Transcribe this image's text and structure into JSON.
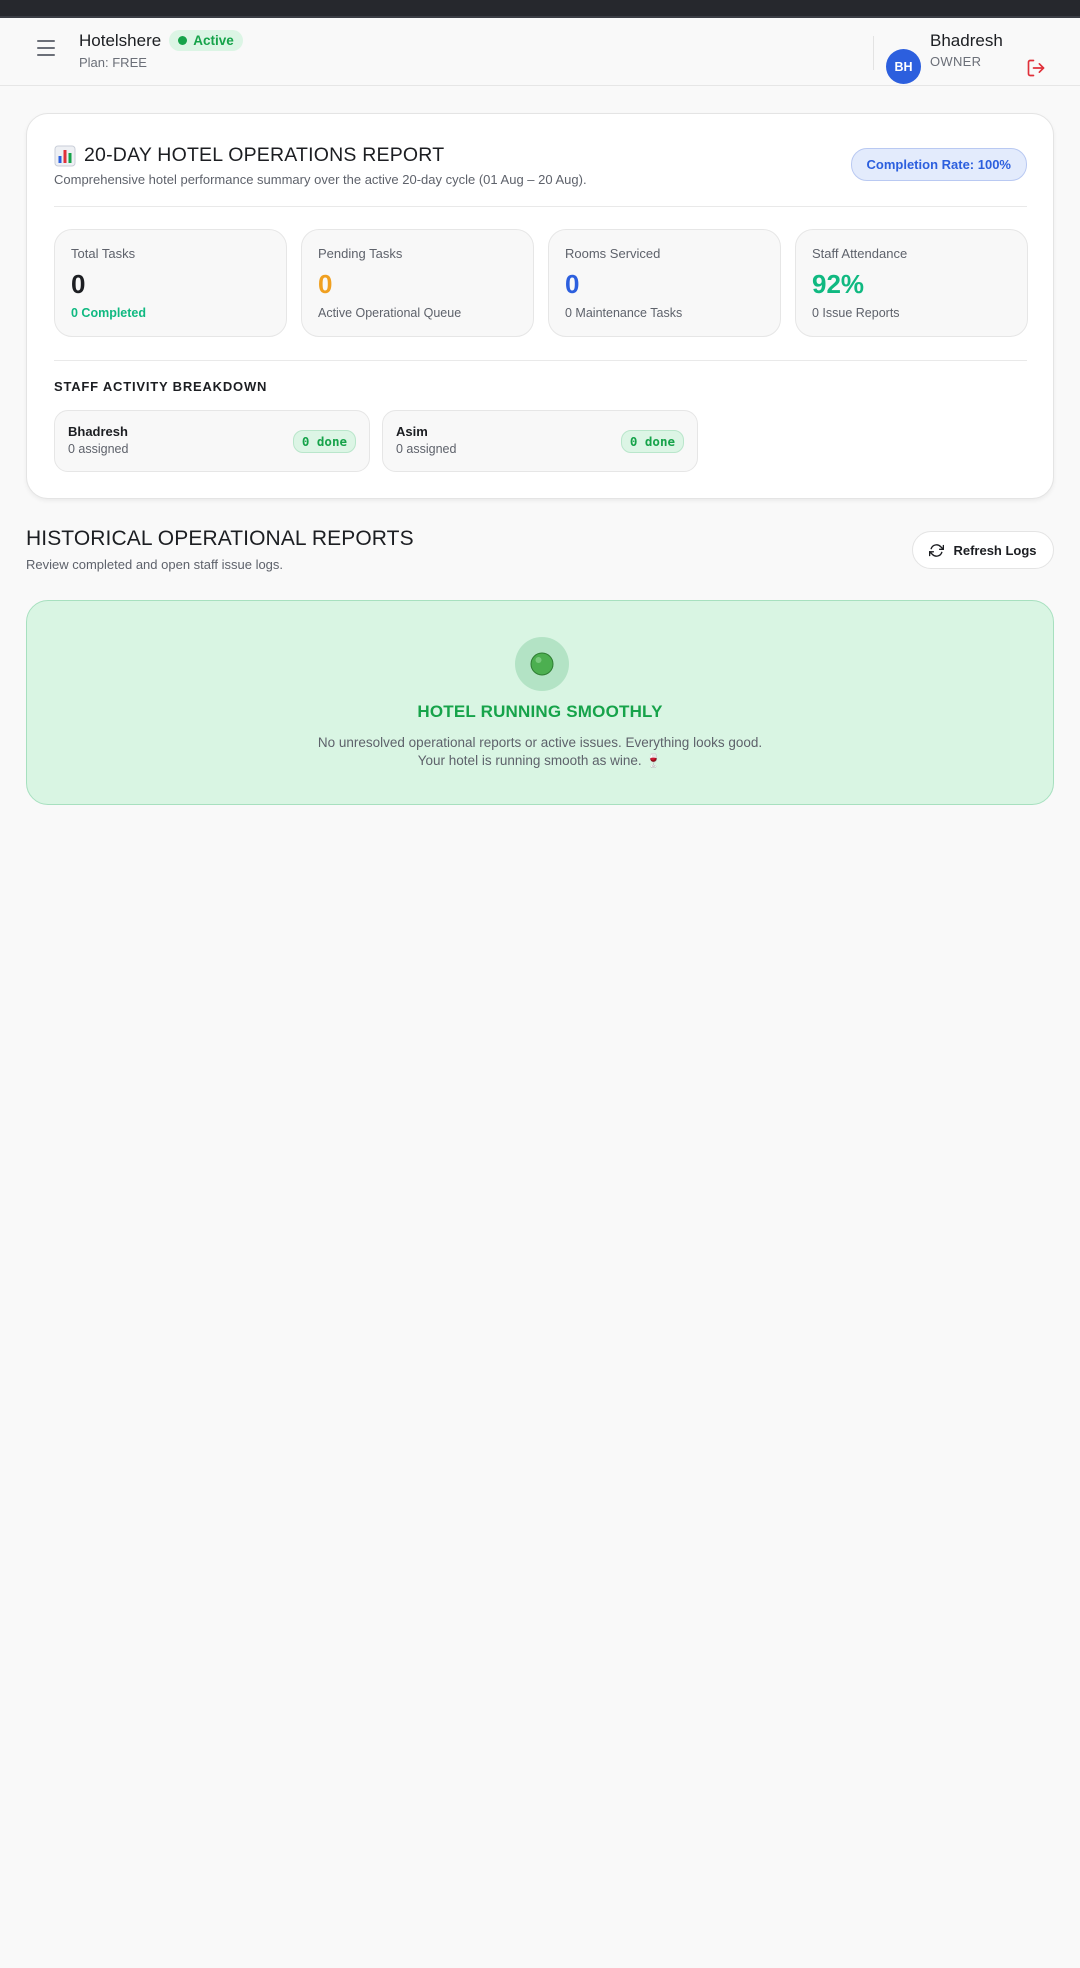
{
  "header": {
    "hotel_name": "Hotelshere",
    "status": "Active",
    "plan": "Plan: FREE",
    "user": {
      "initials": "BH",
      "name": "Bhadresh",
      "role": "OWNER"
    },
    "icons": {
      "menu": "hamburger-menu-icon",
      "logout": "logout-icon"
    }
  },
  "report": {
    "icon": "bar-chart-icon",
    "title": "20-DAY HOTEL OPERATIONS REPORT",
    "subtitle": "Comprehensive hotel performance summary over the active 20-day cycle (01 Aug – 20 Aug).",
    "completion_rate": "Completion Rate: 100%",
    "stats": [
      {
        "label": "Total Tasks",
        "value": "0",
        "sub": "0 Completed",
        "value_color": "#1c1e22",
        "sub_color": "#10b981"
      },
      {
        "label": "Pending Tasks",
        "value": "0",
        "sub": "Active Operational Queue",
        "value_color": "#f0a020",
        "sub_color": "#5e626b"
      },
      {
        "label": "Rooms Serviced",
        "value": "0",
        "sub": "0 Maintenance Tasks",
        "value_color": "#2c5fde",
        "sub_color": "#5e626b"
      },
      {
        "label": "Staff Attendance",
        "value": "92%",
        "sub": "0 Issue Reports",
        "value_color": "#10b981",
        "sub_color": "#5e626b"
      }
    ],
    "staff_heading": "STAFF ACTIVITY BREAKDOWN",
    "staff": [
      {
        "name": "Bhadresh",
        "assigned": "0 assigned",
        "done": "0 done"
      },
      {
        "name": "Asim",
        "assigned": "0 assigned",
        "done": "0 done"
      }
    ]
  },
  "history": {
    "title": "HISTORICAL OPERATIONAL REPORTS",
    "subtitle": "Review completed and open staff issue logs.",
    "refresh_label": "Refresh Logs",
    "refresh_icon": "refresh-icon"
  },
  "status_panel": {
    "icon": "green-circle-icon",
    "title": "HOTEL RUNNING SMOOTHLY",
    "line1": "No unresolved operational reports or active issues. Everything looks good.",
    "line2": "Your hotel is running smooth as wine. 🍷"
  },
  "colors": {
    "accent_blue": "#2c5fde",
    "success_green": "#16a34a",
    "warning_orange": "#f0a020",
    "logout_red": "#e0303a"
  }
}
